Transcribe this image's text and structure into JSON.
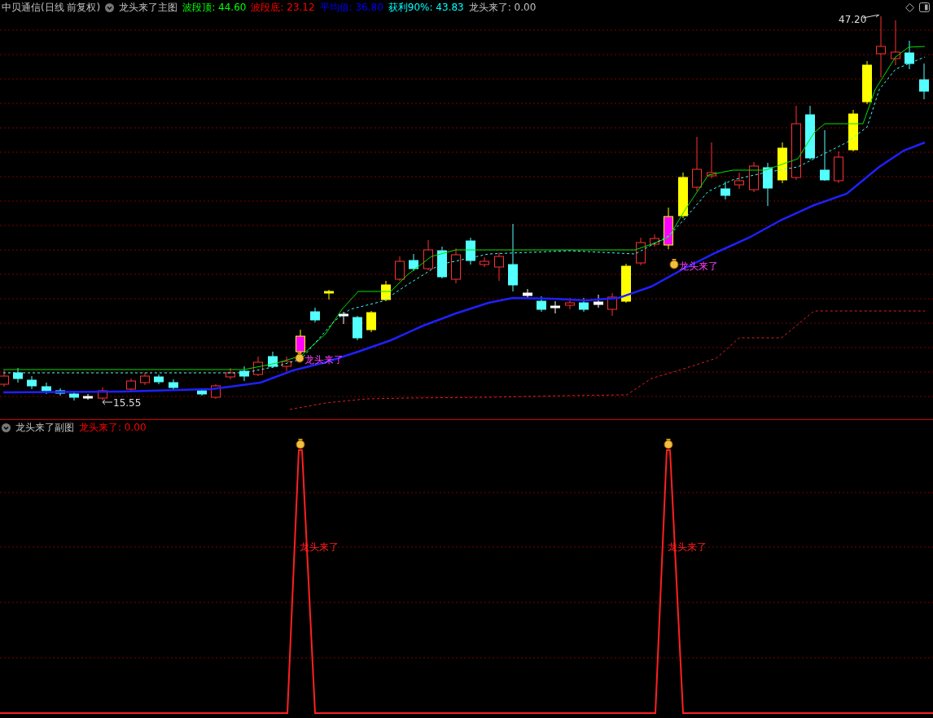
{
  "main_header": {
    "stock": "中贝通信(日线 前复权)",
    "indicator": "龙头来了主图",
    "readouts": [
      {
        "text": "波段顶: 44.60",
        "color": "#00ff00"
      },
      {
        "text": "波段底: 23.12",
        "color": "#ff0000"
      },
      {
        "text": "平均值: 36.80",
        "color": "#0000ff"
      },
      {
        "text": "获利90%: 43.83",
        "color": "#00ffff"
      },
      {
        "text": "龙头来了: 0.00",
        "color": "#c0c0c0"
      }
    ]
  },
  "main_chart": {
    "high_label": "47.20",
    "low_label": "15.55",
    "signals": [
      {
        "label": "龙头来了"
      },
      {
        "label": "龙头来了"
      }
    ]
  },
  "sub_header": {
    "indicator": "龙头来了副图",
    "readouts": [
      {
        "text": "龙头来了: 0.00",
        "color": "#ff0000"
      }
    ]
  },
  "sub_chart": {
    "signals": [
      {
        "label": "龙头来了"
      },
      {
        "label": "龙头来了"
      }
    ]
  }
}
